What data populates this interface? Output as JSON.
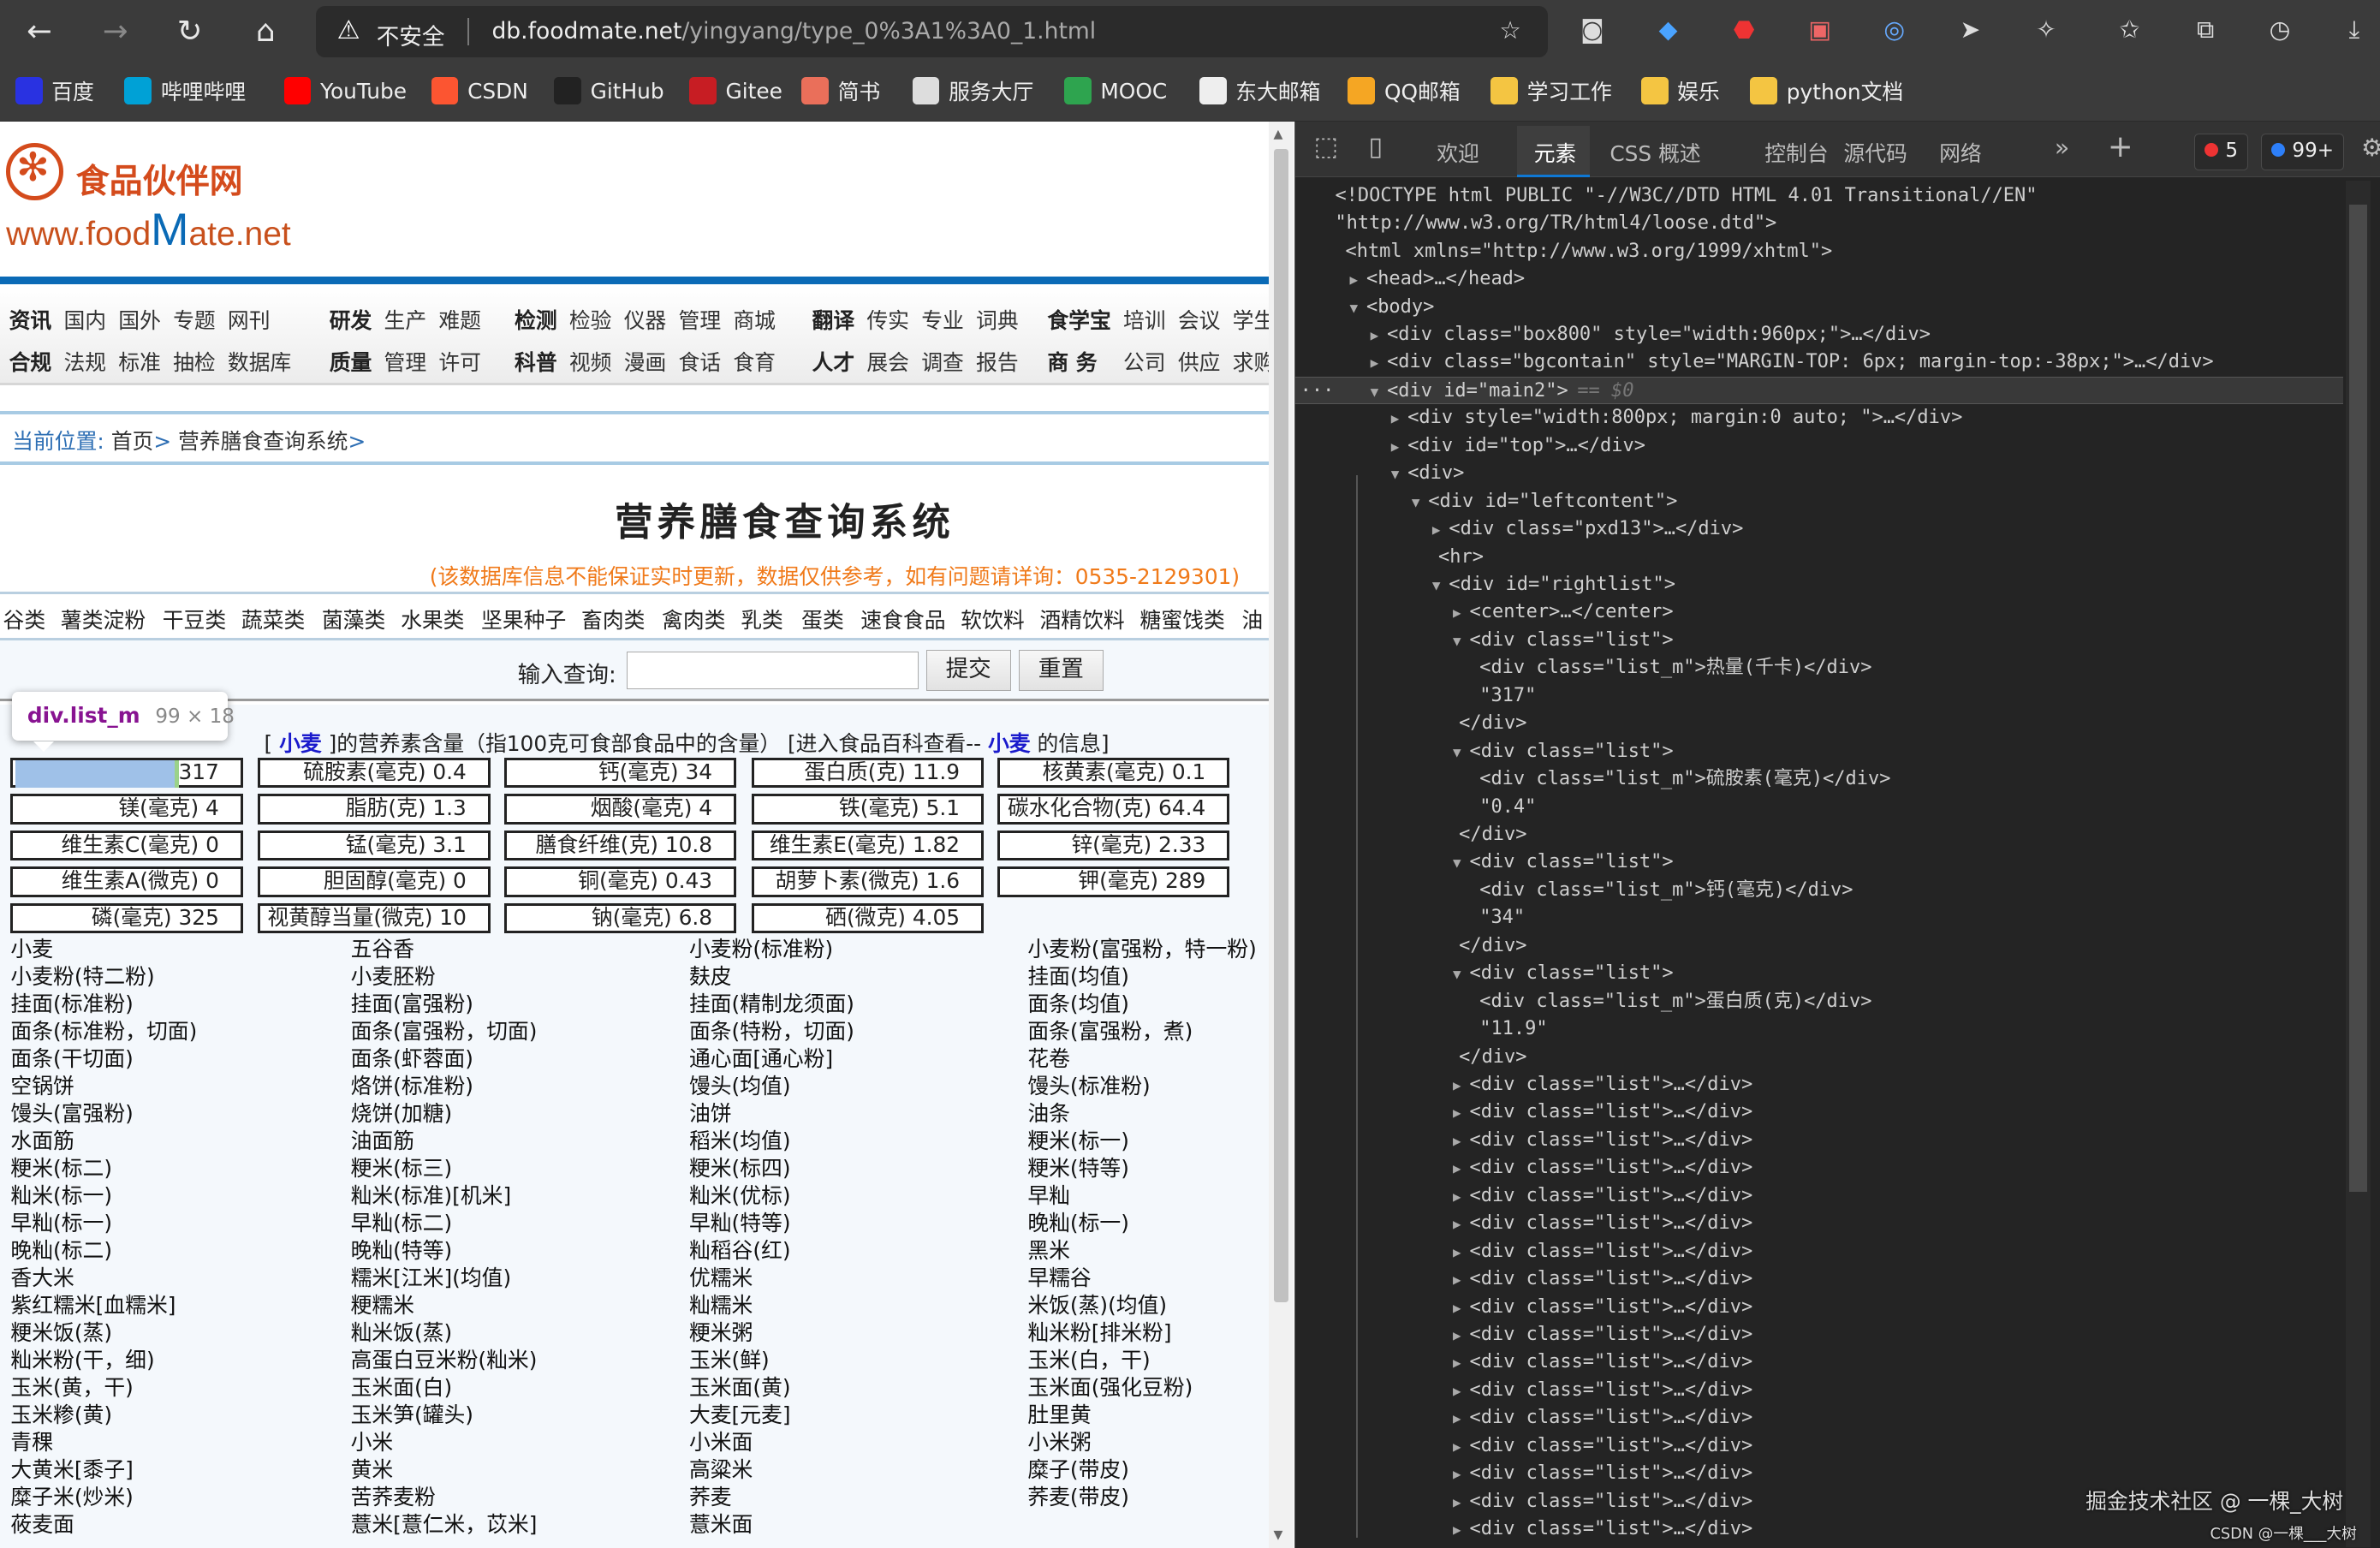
{
  "browser": {
    "security_label": "不安全",
    "url_host": "db.foodmate.net",
    "url_path": "/yingyang/type_0%3A1%3A0_1.html",
    "bookmarks": [
      {
        "label": "百度",
        "icon": "baidu-icon",
        "color": "#2932e1"
      },
      {
        "label": "哔哩哔哩",
        "icon": "bilibili-icon",
        "color": "#00a1d6"
      },
      {
        "label": "YouTube",
        "icon": "youtube-icon",
        "color": "#ff0000"
      },
      {
        "label": "CSDN",
        "icon": "csdn-icon",
        "color": "#fc5531"
      },
      {
        "label": "GitHub",
        "icon": "github-icon",
        "color": "#222222"
      },
      {
        "label": "Gitee",
        "icon": "gitee-icon",
        "color": "#c71d23"
      },
      {
        "label": "简书",
        "icon": "jianshu-icon",
        "color": "#ea6f5a"
      },
      {
        "label": "服务大厅",
        "icon": "home-icon",
        "color": "#dddddd"
      },
      {
        "label": "MOOC",
        "icon": "mooc-icon",
        "color": "#2ea44f"
      },
      {
        "label": "东大邮箱",
        "icon": "page-icon",
        "color": "#eeeeee"
      },
      {
        "label": "QQ邮箱",
        "icon": "qqmail-icon",
        "color": "#f5a623"
      },
      {
        "label": "学习工作",
        "icon": "folder-icon",
        "color": "#f4c542"
      },
      {
        "label": "娱乐",
        "icon": "folder-icon",
        "color": "#f4c542"
      },
      {
        "label": "python文档",
        "icon": "folder-icon",
        "color": "#f4c542"
      }
    ]
  },
  "site": {
    "logo_cn": "食品伙伴网",
    "logo_en_1": "www.food",
    "logo_en_2": "M",
    "logo_en_3": "ate.net",
    "nav_row1": [
      {
        "bold": "资讯",
        "items": [
          "国内",
          "国外",
          "专题",
          "网刊"
        ]
      },
      {
        "bold": "研发",
        "items": [
          "生产",
          "难题"
        ]
      },
      {
        "bold": "检测",
        "items": [
          "检验",
          "仪器",
          "管理",
          "商城"
        ]
      },
      {
        "bold": "翻译",
        "items": [
          "传实",
          "专业",
          "词典"
        ]
      },
      {
        "bold": "食学宝",
        "items": [
          "培训",
          "会议",
          "学生"
        ]
      }
    ],
    "nav_row2": [
      {
        "bold": "合规",
        "items": [
          "法规",
          "标准",
          "抽检",
          "数据库"
        ]
      },
      {
        "bold": "质量",
        "items": [
          "管理",
          "许可"
        ]
      },
      {
        "bold": "科普",
        "items": [
          "视频",
          "漫画",
          "食话",
          "食育"
        ]
      },
      {
        "bold": "人才",
        "items": [
          "展会",
          "调查",
          "报告"
        ]
      },
      {
        "bold": "商 务",
        "items": [
          "公司",
          "供应",
          "求购"
        ]
      }
    ],
    "breadcrumb": {
      "label": "当前位置:",
      "home": "首页",
      "current": "营养膳食查询系统"
    },
    "title": "营养膳食查询系统",
    "notice": "(该数据库信息不能保证实时更新，数据仅供参考，如有问题请详询：0535-2129301)",
    "categories": [
      "谷类",
      "薯类淀粉",
      "干豆类",
      "蔬菜类",
      "菌藻类",
      "水果类",
      "坚果种子",
      "畜肉类",
      "禽肉类",
      "乳类",
      "蛋类",
      "速食食品",
      "软饮料",
      "酒精饮料",
      "糖蜜饯类",
      "油"
    ],
    "search": {
      "label": "输入查询:",
      "value": "",
      "submit": "提交",
      "reset": "重置"
    },
    "food_name": "小麦",
    "heading_pre": "[",
    "heading_mid": "]的营养素含量（指100克可食部食品中的含量）  [进入食品百科查看--",
    "heading_post": "的信息]",
    "nutrients": [
      "热量(千卡) 317",
      "硫胺素(毫克) 0.4",
      "钙(毫克) 34",
      "蛋白质(克) 11.9",
      "核黄素(毫克) 0.1",
      "镁(毫克) 4",
      "脂肪(克) 1.3",
      "烟酸(毫克) 4",
      "铁(毫克) 5.1",
      "碳水化合物(克) 64.4",
      "维生素C(毫克) 0",
      "锰(毫克) 3.1",
      "膳食纤维(克) 10.8",
      "维生素E(毫克) 1.82",
      "锌(毫克) 2.33",
      "维生素A(微克) 0",
      "胆固醇(毫克) 0",
      "铜(毫克) 0.43",
      "胡萝卜素(微克) 1.6",
      "钾(毫克) 289",
      "磷(毫克) 325",
      "视黄醇当量(微克) 10",
      "钠(毫克) 6.8",
      "硒(微克) 4.05"
    ],
    "foods": [
      "小麦",
      "五谷香",
      "小麦粉(标准粉)",
      "小麦粉(富强粉，特一粉)",
      "小麦粉(特二粉)",
      "小麦胚粉",
      "麸皮",
      "挂面(均值)",
      "挂面(标准粉)",
      "挂面(富强粉)",
      "挂面(精制龙须面)",
      "面条(均值)",
      "面条(标准粉，切面)",
      "面条(富强粉，切面)",
      "面条(特粉，切面)",
      "面条(富强粉，煮)",
      "面条(干切面)",
      "面条(虾蓉面)",
      "通心面[通心粉]",
      "花卷",
      "空锅饼",
      "烙饼(标准粉)",
      "馒头(均值)",
      "馒头(标准粉)",
      "馒头(富强粉)",
      "烧饼(加糖)",
      "油饼",
      "油条",
      "水面筋",
      "油面筋",
      "稻米(均值)",
      "粳米(标一)",
      "粳米(标二)",
      "粳米(标三)",
      "粳米(标四)",
      "粳米(特等)",
      "籼米(标一)",
      "籼米(标准)[机米]",
      "籼米(优标)",
      "早籼",
      "早籼(标一)",
      "早籼(标二)",
      "早籼(特等)",
      "晚籼(标一)",
      "晚籼(标二)",
      "晚籼(特等)",
      "籼稻谷(红)",
      "黑米",
      "香大米",
      "糯米[江米](均值)",
      "优糯米",
      "早糯谷",
      "紫红糯米[血糯米]",
      "粳糯米",
      "籼糯米",
      "米饭(蒸)(均值)",
      "粳米饭(蒸)",
      "籼米饭(蒸)",
      "粳米粥",
      "籼米粉[排米粉]",
      "籼米粉(干，细)",
      "高蛋白豆米粉(籼米)",
      "玉米(鲜)",
      "玉米(白，干)",
      "玉米(黄，干)",
      "玉米面(白)",
      "玉米面(黄)",
      "玉米面(强化豆粉)",
      "玉米糁(黄)",
      "玉米笋(罐头)",
      "大麦[元麦]",
      "肚里黄",
      "青稞",
      "小米",
      "小米面",
      "小米粥",
      "大黄米[黍子]",
      "黄米",
      "高粱米",
      "糜子(带皮)",
      "糜子米(炒米)",
      "苦荞麦粉",
      "荞麦",
      "荞麦(带皮)",
      "莜麦面",
      "薏米[薏仁米，苡米]",
      "薏米面"
    ]
  },
  "inspector_tooltip": {
    "selector": "div.list_m",
    "size": "99 × 18"
  },
  "devtools": {
    "tabs": [
      "欢迎",
      "元素",
      "CSS 概述",
      "控制台",
      "源代码",
      "网络"
    ],
    "active_tab": "元素",
    "errors": "5",
    "messages": "99+",
    "selected_marker": "== $0",
    "lines": [
      {
        "l": 0,
        "a": "",
        "t": "<!DOCTYPE html PUBLIC \"-//W3C//DTD HTML 4.01 Transitional//EN\""
      },
      {
        "l": 0,
        "a": "",
        "t": "\"http://www.w3.org/TR/html4/loose.dtd\">"
      },
      {
        "l": 0.5,
        "a": "",
        "t": "<html xmlns=\"http://www.w3.org/1999/xhtml\">"
      },
      {
        "l": 1,
        "a": "c",
        "t": "<head>…</head>"
      },
      {
        "l": 1,
        "a": "o",
        "t": "<body>"
      },
      {
        "l": 2,
        "a": "c",
        "t": "<div class=\"box800\" style=\"width:960px;\">…</div>"
      },
      {
        "l": 2,
        "a": "c",
        "t": "<div class=\"bgcontain\" style=\"MARGIN-TOP: 6px; margin-top:-38px;\">…</div>"
      },
      {
        "l": 2,
        "a": "o",
        "t": "<div id=\"main2\">",
        "sel": true
      },
      {
        "l": 3,
        "a": "c",
        "t": "<div style=\"width:800px; margin:0 auto; \">…</div>"
      },
      {
        "l": 3,
        "a": "c",
        "t": "<div id=\"top\">…</div>"
      },
      {
        "l": 3,
        "a": "o",
        "t": "<div>"
      },
      {
        "l": 4,
        "a": "o",
        "t": "<div id=\"leftcontent\">"
      },
      {
        "l": 5,
        "a": "c",
        "t": "<div class=\"pxd13\">…</div>"
      },
      {
        "l": 5,
        "a": "",
        "t": "<hr>"
      },
      {
        "l": 5,
        "a": "o",
        "t": "<div id=\"rightlist\">"
      },
      {
        "l": 6,
        "a": "c",
        "t": "<center>…</center>"
      },
      {
        "l": 6,
        "a": "o",
        "t": "<div class=\"list\">"
      },
      {
        "l": 7,
        "a": "",
        "t": "<div class=\"list_m\">热量(千卡)</div>"
      },
      {
        "l": 7,
        "a": "",
        "t": "\"317\""
      },
      {
        "l": 6,
        "a": "",
        "t": "</div>"
      },
      {
        "l": 6,
        "a": "o",
        "t": "<div class=\"list\">"
      },
      {
        "l": 7,
        "a": "",
        "t": "<div class=\"list_m\">硫胺素(毫克)</div>"
      },
      {
        "l": 7,
        "a": "",
        "t": "\"0.4\""
      },
      {
        "l": 6,
        "a": "",
        "t": "</div>"
      },
      {
        "l": 6,
        "a": "o",
        "t": "<div class=\"list\">"
      },
      {
        "l": 7,
        "a": "",
        "t": "<div class=\"list_m\">钙(毫克)</div>"
      },
      {
        "l": 7,
        "a": "",
        "t": "\"34\""
      },
      {
        "l": 6,
        "a": "",
        "t": "</div>"
      },
      {
        "l": 6,
        "a": "o",
        "t": "<div class=\"list\">"
      },
      {
        "l": 7,
        "a": "",
        "t": "<div class=\"list_m\">蛋白质(克)</div>"
      },
      {
        "l": 7,
        "a": "",
        "t": "\"11.9\""
      },
      {
        "l": 6,
        "a": "",
        "t": "</div>"
      },
      {
        "l": 6,
        "a": "c",
        "t": "<div class=\"list\">…</div>"
      },
      {
        "l": 6,
        "a": "c",
        "t": "<div class=\"list\">…</div>"
      },
      {
        "l": 6,
        "a": "c",
        "t": "<div class=\"list\">…</div>"
      },
      {
        "l": 6,
        "a": "c",
        "t": "<div class=\"list\">…</div>"
      },
      {
        "l": 6,
        "a": "c",
        "t": "<div class=\"list\">…</div>"
      },
      {
        "l": 6,
        "a": "c",
        "t": "<div class=\"list\">…</div>"
      },
      {
        "l": 6,
        "a": "c",
        "t": "<div class=\"list\">…</div>"
      },
      {
        "l": 6,
        "a": "c",
        "t": "<div class=\"list\">…</div>"
      },
      {
        "l": 6,
        "a": "c",
        "t": "<div class=\"list\">…</div>"
      },
      {
        "l": 6,
        "a": "c",
        "t": "<div class=\"list\">…</div>"
      },
      {
        "l": 6,
        "a": "c",
        "t": "<div class=\"list\">…</div>"
      },
      {
        "l": 6,
        "a": "c",
        "t": "<div class=\"list\">…</div>"
      },
      {
        "l": 6,
        "a": "c",
        "t": "<div class=\"list\">…</div>"
      },
      {
        "l": 6,
        "a": "c",
        "t": "<div class=\"list\">…</div>"
      },
      {
        "l": 6,
        "a": "c",
        "t": "<div class=\"list\">…</div>"
      },
      {
        "l": 6,
        "a": "c",
        "t": "<div class=\"list\">…</div>"
      },
      {
        "l": 6,
        "a": "c",
        "t": "<div class=\"list\">…</div>"
      }
    ]
  },
  "watermarks": [
    "掘金技术社区 @ 一棵_大树",
    "CSDN @一棵___大树"
  ]
}
